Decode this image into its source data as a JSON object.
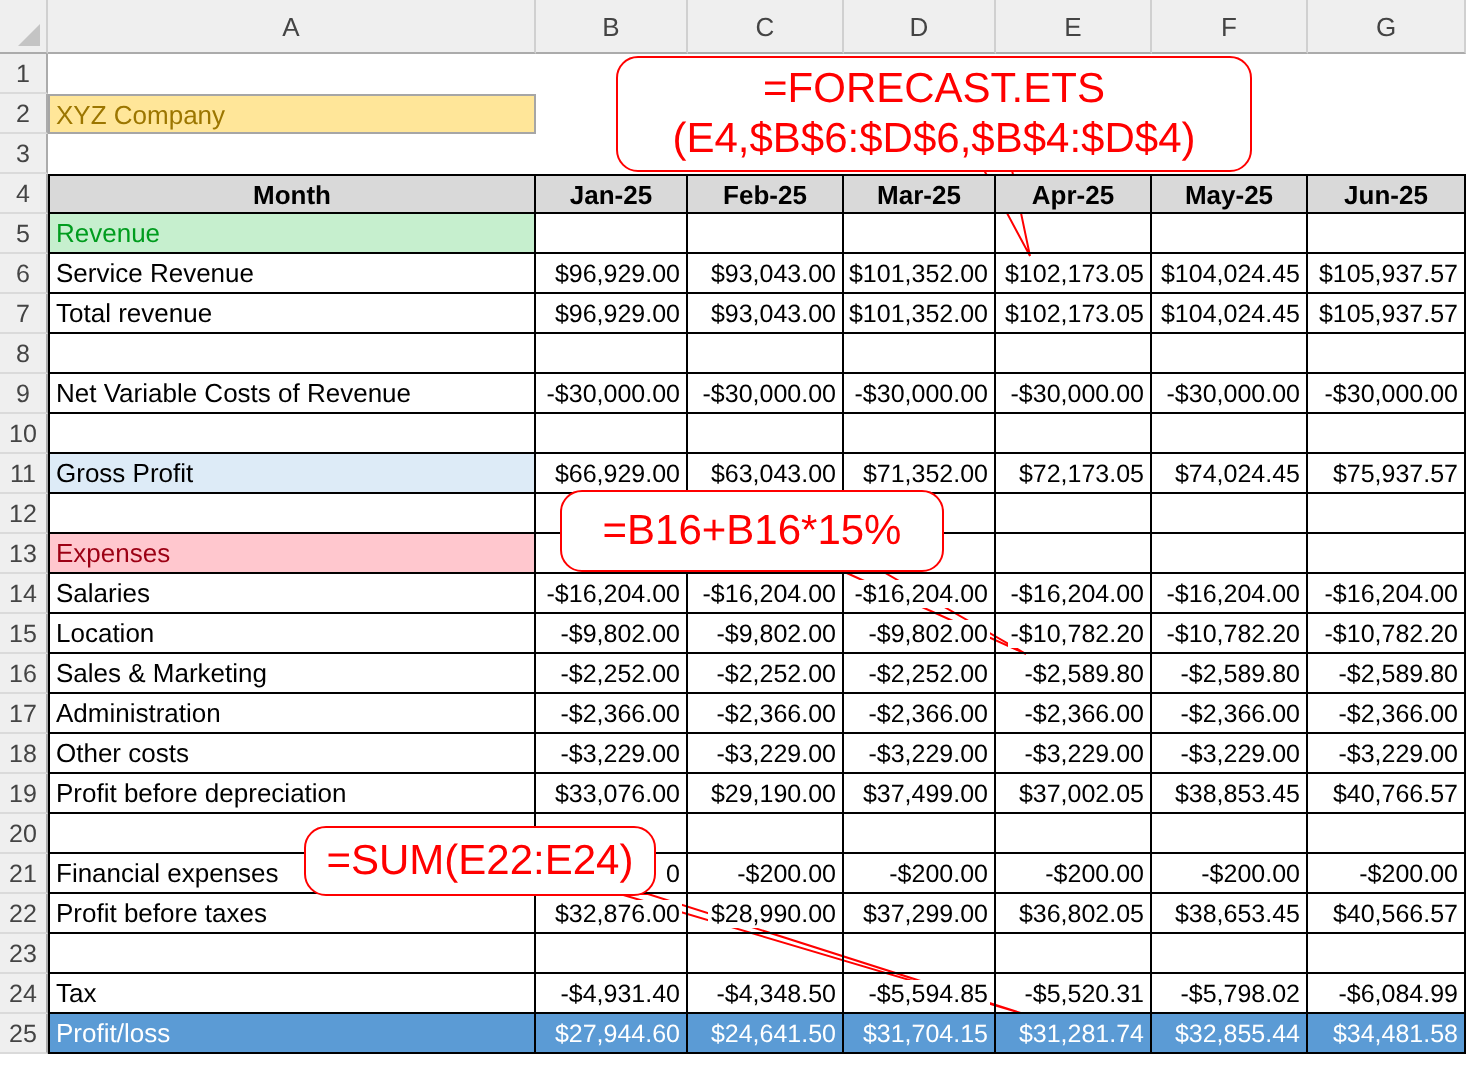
{
  "sheet": {
    "columns": [
      "A",
      "B",
      "C",
      "D",
      "E",
      "F",
      "G"
    ],
    "rows": [
      {
        "number": "1",
        "kind": "plain"
      },
      {
        "number": "2",
        "kind": "title",
        "color": "#ffe699",
        "cells": [
          "XYZ Company"
        ]
      },
      {
        "number": "3",
        "kind": "plain"
      },
      {
        "number": "4",
        "kind": "header",
        "cells": [
          "Month",
          "Jan-25",
          "Feb-25",
          "Mar-25",
          "Apr-25",
          "May-25",
          "Jun-25"
        ]
      },
      {
        "number": "5",
        "kind": "section",
        "color": "#c6efce",
        "cells": [
          "Revenue"
        ]
      },
      {
        "number": "6",
        "kind": "data",
        "cells": [
          "Service Revenue",
          "$96,929.00",
          "$93,043.00",
          "$101,352.00",
          "$102,173.05",
          "$104,024.45",
          "$105,937.57"
        ]
      },
      {
        "number": "7",
        "kind": "data",
        "cells": [
          "Total revenue",
          "$96,929.00",
          "$93,043.00",
          "$101,352.00",
          "$102,173.05",
          "$104,024.45",
          "$105,937.57"
        ]
      },
      {
        "number": "8",
        "kind": "blank"
      },
      {
        "number": "9",
        "kind": "data",
        "cells": [
          "Net Variable Costs of Revenue",
          "-$30,000.00",
          "-$30,000.00",
          "-$30,000.00",
          "-$30,000.00",
          "-$30,000.00",
          "-$30,000.00"
        ]
      },
      {
        "number": "10",
        "kind": "blank"
      },
      {
        "number": "11",
        "kind": "section",
        "color": "#ddebf7",
        "cells": [
          "Gross Profit",
          "$66,929.00",
          "$63,043.00",
          "$71,352.00",
          "$72,173.05",
          "$74,024.45",
          "$75,937.57"
        ]
      },
      {
        "number": "12",
        "kind": "blank"
      },
      {
        "number": "13",
        "kind": "section",
        "color": "#ffc7ce",
        "cells": [
          "Expenses"
        ]
      },
      {
        "number": "14",
        "kind": "data",
        "cells": [
          "Salaries",
          "-$16,204.00",
          "-$16,204.00",
          "-$16,204.00",
          "-$16,204.00",
          "-$16,204.00",
          "-$16,204.00"
        ]
      },
      {
        "number": "15",
        "kind": "data",
        "cells": [
          "Location",
          "-$9,802.00",
          "-$9,802.00",
          "-$9,802.00",
          "-$10,782.20",
          "-$10,782.20",
          "-$10,782.20"
        ]
      },
      {
        "number": "16",
        "kind": "data",
        "cells": [
          "Sales & Marketing",
          "-$2,252.00",
          "-$2,252.00",
          "-$2,252.00",
          "-$2,589.80",
          "-$2,589.80",
          "-$2,589.80"
        ]
      },
      {
        "number": "17",
        "kind": "data",
        "cells": [
          "Administration",
          "-$2,366.00",
          "-$2,366.00",
          "-$2,366.00",
          "-$2,366.00",
          "-$2,366.00",
          "-$2,366.00"
        ]
      },
      {
        "number": "18",
        "kind": "data",
        "cells": [
          "Other costs",
          "-$3,229.00",
          "-$3,229.00",
          "-$3,229.00",
          "-$3,229.00",
          "-$3,229.00",
          "-$3,229.00"
        ]
      },
      {
        "number": "19",
        "kind": "data",
        "cells": [
          "Profit before depreciation",
          "$33,076.00",
          "$29,190.00",
          "$37,499.00",
          "$37,002.05",
          "$38,853.45",
          "$40,766.57"
        ]
      },
      {
        "number": "20",
        "kind": "blank"
      },
      {
        "number": "21",
        "kind": "data",
        "cells": [
          "Financial expenses",
          "0",
          "-$200.00",
          "-$200.00",
          "-$200.00",
          "-$200.00",
          "-$200.00"
        ]
      },
      {
        "number": "22",
        "kind": "data",
        "cells": [
          "Profit before taxes",
          "$32,876.00",
          "$28,990.00",
          "$37,299.00",
          "$36,802.05",
          "$38,653.45",
          "$40,566.57"
        ]
      },
      {
        "number": "23",
        "kind": "blank"
      },
      {
        "number": "24",
        "kind": "data",
        "cells": [
          "Tax",
          "-$4,931.40",
          "-$4,348.50",
          "-$5,594.85",
          "-$5,520.31",
          "-$5,798.02",
          "-$6,084.99"
        ]
      },
      {
        "number": "25",
        "kind": "total",
        "color": "#5b9bd5",
        "cells": [
          "Profit/loss",
          "$27,944.60",
          "$24,641.50",
          "$31,704.15",
          "$31,281.74",
          "$32,855.44",
          "$34,481.58"
        ]
      }
    ]
  },
  "callouts": [
    {
      "lines": [
        "=FORECAST.ETS",
        "(E4,$B$6:$D$6,$B$4:$D$4)"
      ]
    },
    {
      "lines": [
        "=B16+B16*15%"
      ]
    },
    {
      "lines": [
        "=SUM(E22:E24)"
      ]
    }
  ]
}
